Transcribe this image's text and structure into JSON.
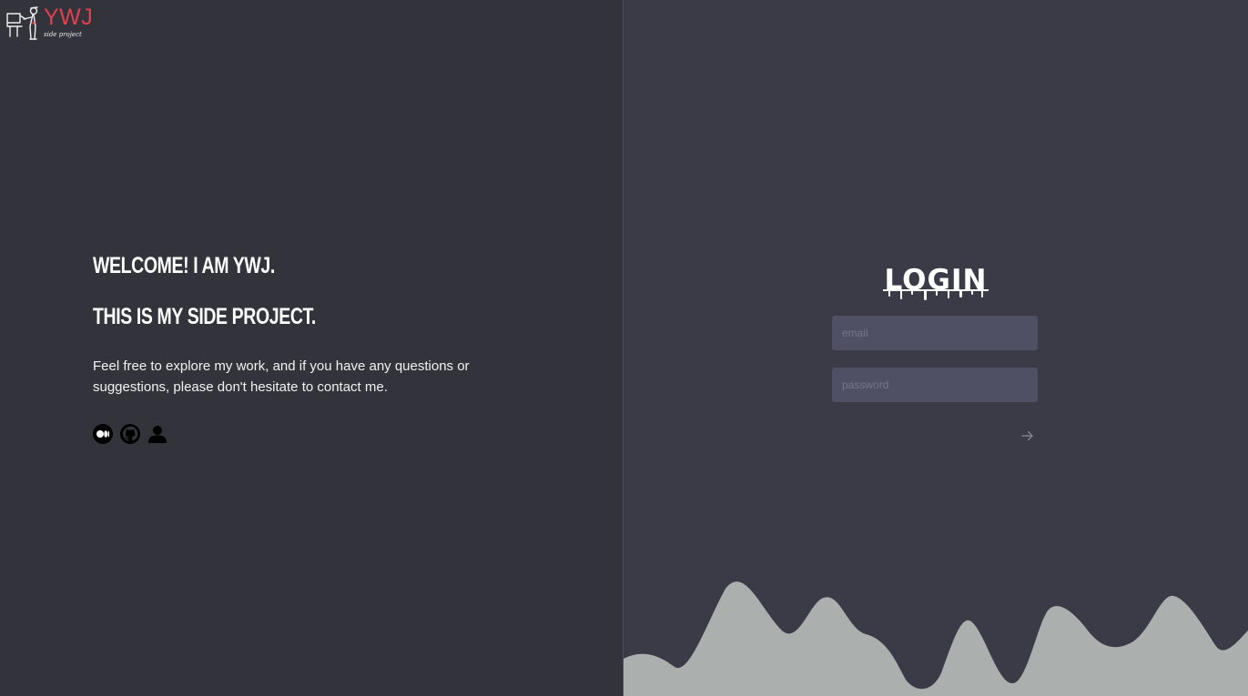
{
  "brand": {
    "title": "YWJ",
    "subtitle": "side project",
    "accent_color": "#e0404f"
  },
  "welcome": {
    "headline_1": "Welcome! I am YWJ.",
    "headline_2": "This is my side project.",
    "description": "Feel free to explore my work, and if you have any questions or suggestions, please don't hesitate to contact me."
  },
  "socials": [
    {
      "icon": "medium-icon"
    },
    {
      "icon": "github-icon"
    },
    {
      "icon": "profile-icon"
    }
  ],
  "login": {
    "title": "LOGIN",
    "email_placeholder": "email",
    "password_placeholder": "password",
    "submit_icon": "arrow-right-icon"
  },
  "colors": {
    "left_background": "#33333b",
    "right_background": "#3a3b47",
    "input_background": "#4f5063",
    "wave_color": "#abafad"
  }
}
